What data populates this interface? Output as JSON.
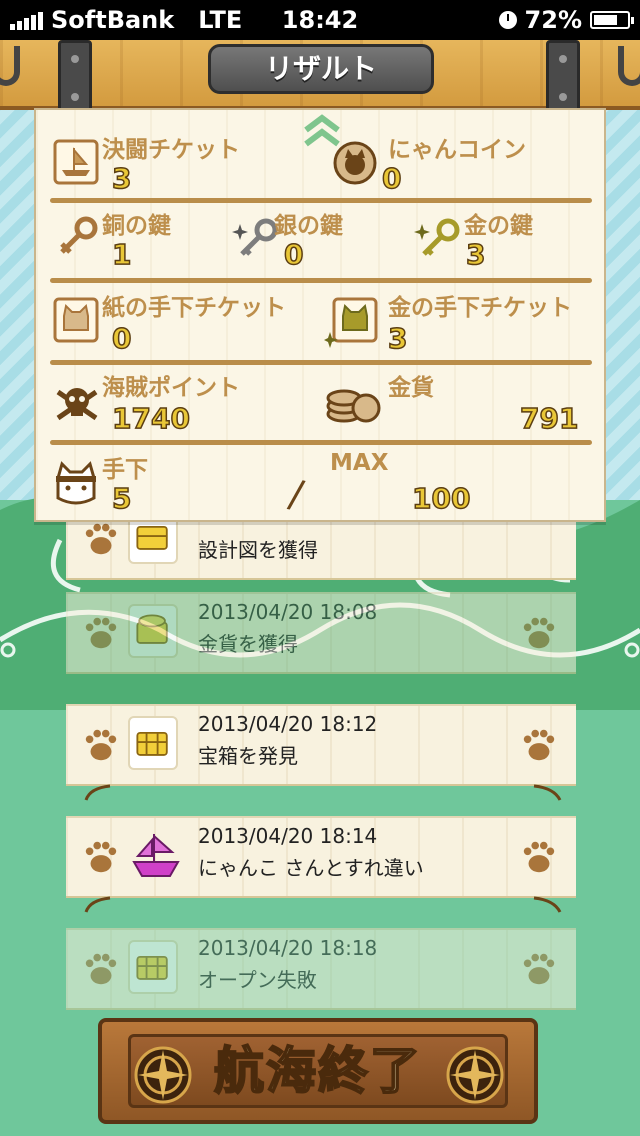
{
  "status_bar": {
    "carrier": "SoftBank",
    "network": "LTE",
    "time": "18:42",
    "battery": "72%",
    "battery_level": 0.72
  },
  "header": {
    "title": "リザルト"
  },
  "results": {
    "duel_ticket": {
      "label": "決闘チケット",
      "value": "3"
    },
    "nyan_coin": {
      "label": "にゃんコイン",
      "value": "0"
    },
    "copper_key": {
      "label": "銅の鍵",
      "value": "1"
    },
    "silver_key": {
      "label": "銀の鍵",
      "value": "0"
    },
    "gold_key": {
      "label": "金の鍵",
      "value": "3"
    },
    "paper_minion_ticket": {
      "label": "紙の手下チケット",
      "value": "0"
    },
    "gold_minion_ticket": {
      "label": "金の手下チケット",
      "value": "3"
    },
    "pirate_points": {
      "label": "海賊ポイント",
      "value": "1740"
    },
    "gold_coins": {
      "label": "金貨",
      "value": "791"
    },
    "minions": {
      "label": "手下",
      "value": "5",
      "separator": "/",
      "max_label": "MAX",
      "max_value": "100"
    }
  },
  "log": [
    {
      "date": "",
      "message": "設計図を獲得",
      "icon": "treasure-chest-icon"
    },
    {
      "date": "2013/04/20 18:08",
      "message": "金貨を獲得",
      "icon": "gold-treasure-icon"
    },
    {
      "date": "2013/04/20 18:12",
      "message": "宝箱を発見",
      "icon": "treasure-chest-icon"
    },
    {
      "date": "2013/04/20 18:14",
      "message": "にゃんこ さんとすれ違い",
      "icon": "pirate-ship-icon"
    },
    {
      "date": "2013/04/20 18:18",
      "message": "オープン失敗",
      "icon": "treasure-chest-icon"
    }
  ],
  "footer": {
    "end_button_label": "航海終了"
  },
  "colors": {
    "wood": "#d39b3f",
    "paper": "#fbf6e6",
    "label_brown": "#bd8f4c",
    "value_yellow": "#e9c737",
    "sea_green": "#6fc79b",
    "sky_stripe": "#a8dde6"
  }
}
